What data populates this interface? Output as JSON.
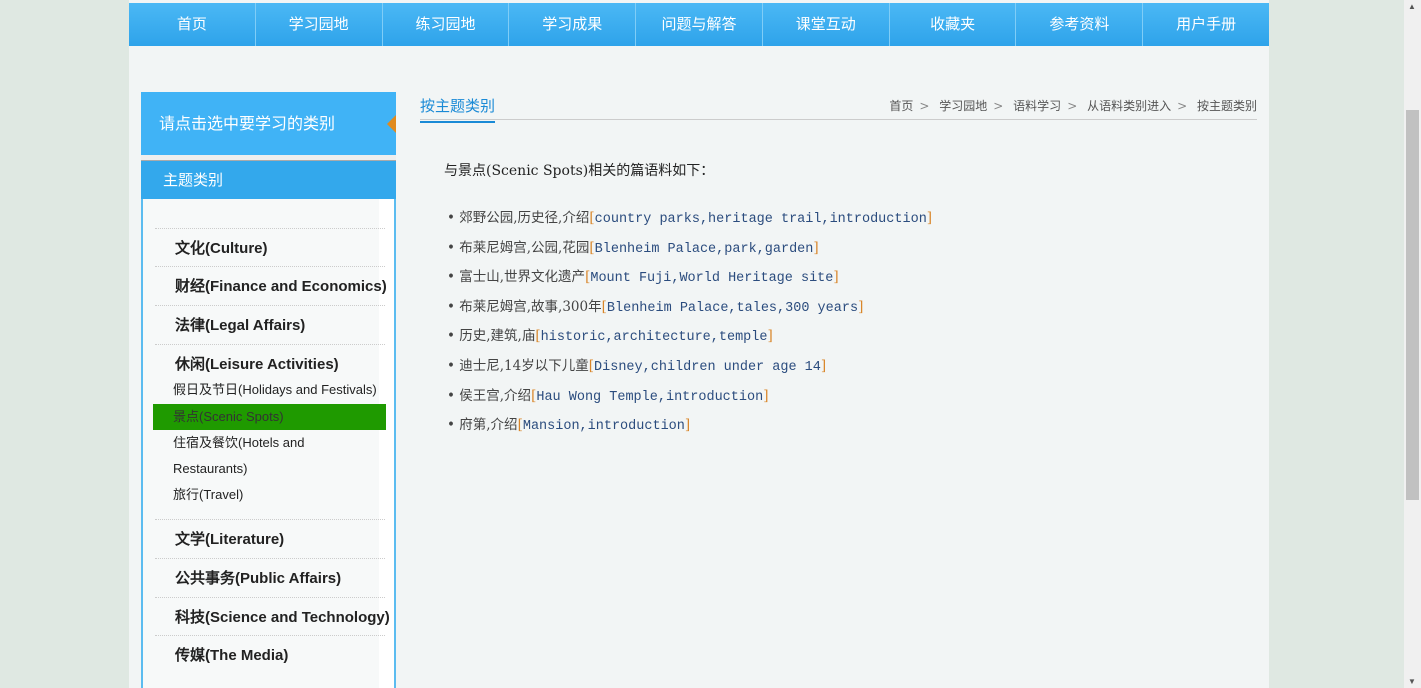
{
  "nav": [
    "首页",
    "学习园地",
    "练习园地",
    "学习成果",
    "问题与解答",
    "课堂互动",
    "收藏夹",
    "参考资料",
    "用户手册"
  ],
  "sidebar": {
    "prompt": "请点击选中要学习的类别",
    "header": "主题类别",
    "main": [
      "文化(Culture)",
      "财经(Finance and Economics)",
      "法律(Legal Affairs)",
      "休闲(Leisure Activities)"
    ],
    "subs": [
      "假日及节日(Holidays and Festivals)",
      "景点(Scenic Spots)",
      "住宿及餐饮(Hotels and",
      "Restaurants)",
      "旅行(Travel)"
    ],
    "main2": [
      "文学(Literature)",
      "公共事务(Public Affairs)",
      "科技(Science and Technology)",
      "传媒(The Media)"
    ]
  },
  "tab": "按主题类别",
  "breadcrumb": [
    "首页",
    "学习园地",
    "语料学习",
    "从语料类别进入",
    "按主题类别"
  ],
  "intro": "与景点(Scenic Spots)相关的篇语料如下：",
  "items": [
    {
      "zh": "郊野公园,历史径,介绍",
      "en": "country parks,heritage trail,introduction"
    },
    {
      "zh": "布莱尼姆宫,公园,花园",
      "en": "Blenheim Palace,park,garden"
    },
    {
      "zh": "富士山,世界文化遗产",
      "en": "Mount Fuji,World Heritage site"
    },
    {
      "zh": "布莱尼姆宫,故事,300年",
      "en": "Blenheim Palace,tales,300 years"
    },
    {
      "zh": "历史,建筑,庙",
      "en": "historic,architecture,temple"
    },
    {
      "zh": "迪士尼,14岁以下儿童",
      "en": "Disney,children under age 14"
    },
    {
      "zh": "侯王宫,介绍",
      "en": "Hau Wong Temple,introduction"
    },
    {
      "zh": "府第,介绍",
      "en": "Mansion,introduction"
    }
  ]
}
